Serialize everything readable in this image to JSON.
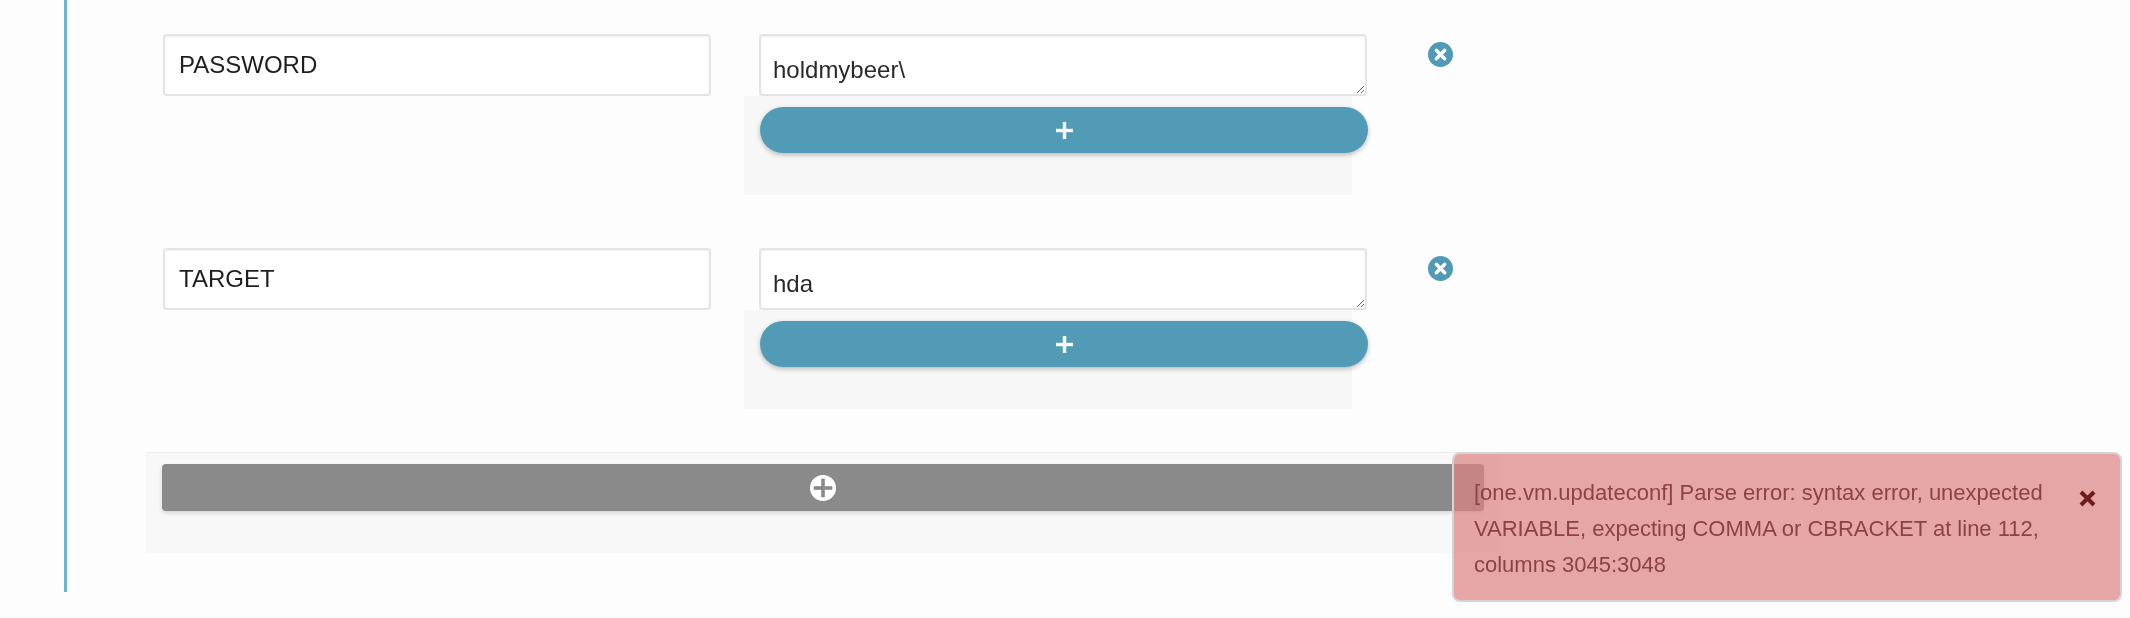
{
  "variables": [
    {
      "key": "PASSWORD",
      "value": "holdmybeer\\"
    },
    {
      "key": "TARGET",
      "value": "hda"
    }
  ],
  "notification": {
    "kind": "error",
    "message": "[one.vm.updateconf] Parse error: syntax error, unexpected VARIABLE, expecting COMMA or CBRACKET at line 112, columns 3045:3048"
  }
}
